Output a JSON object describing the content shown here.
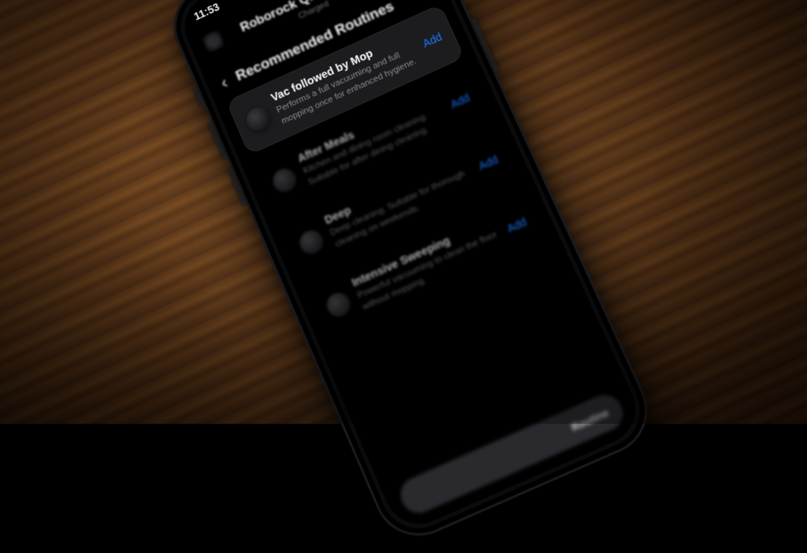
{
  "status": {
    "time": "11:53"
  },
  "header": {
    "title": "Roborock Qrevo Master",
    "subtitle": "Charged"
  },
  "section": {
    "back_glyph": "‹",
    "title": "Recommended Routines"
  },
  "routines": [
    {
      "name": "Vac followed by Mop",
      "desc": "Performs a full vacuuming and full mopping once for enhanced hygiene.",
      "action": "Add",
      "highlight": true
    },
    {
      "name": "After Meals",
      "desc": "Kitchen and dining room cleaning. Suitable for after dining cleaning.",
      "action": "Add",
      "highlight": false
    },
    {
      "name": "Deep",
      "desc": "Deep cleaning. Suitable for thorough cleaning on weekends.",
      "action": "Add",
      "highlight": false
    },
    {
      "name": "Intensive Sweeping",
      "desc": "Powerful vacuuming to clean the floor without mopping.",
      "action": "Add",
      "highlight": false
    }
  ],
  "bottom": {
    "label": "Routine"
  },
  "settings_glyph": "⋯"
}
